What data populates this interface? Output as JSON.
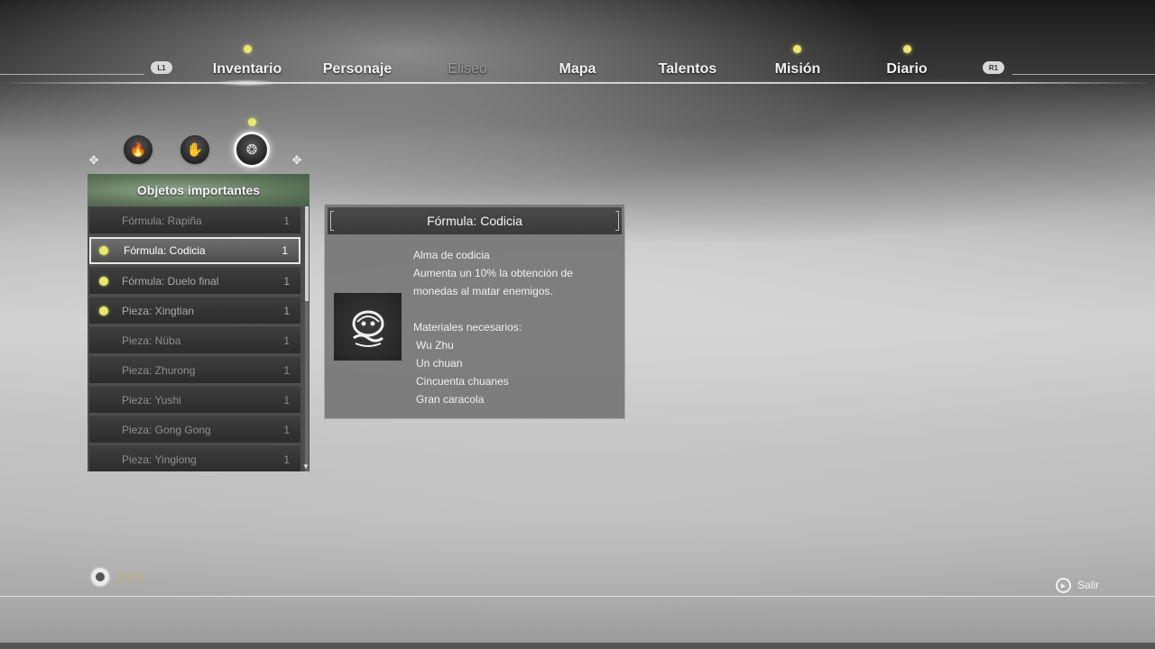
{
  "nav": {
    "left_shoulder": "L1",
    "right_shoulder": "R1",
    "tabs": [
      {
        "label": "Inventario",
        "notification": true,
        "active": true,
        "dim": false
      },
      {
        "label": "Personaje",
        "notification": false,
        "active": false,
        "dim": false
      },
      {
        "label": "Eliseo",
        "notification": false,
        "active": false,
        "dim": true
      },
      {
        "label": "Mapa",
        "notification": false,
        "active": false,
        "dim": false
      },
      {
        "label": "Talentos",
        "notification": false,
        "active": false,
        "dim": false
      },
      {
        "label": "Misión",
        "notification": true,
        "active": false,
        "dim": false
      },
      {
        "label": "Diario",
        "notification": true,
        "active": false,
        "dim": false
      }
    ]
  },
  "categories": [
    {
      "icon": "flame-icon",
      "selected": false,
      "notification": false
    },
    {
      "icon": "hand-icon",
      "selected": false,
      "notification": false
    },
    {
      "icon": "relic-icon",
      "selected": true,
      "notification": true
    }
  ],
  "list": {
    "header": "Objetos importantes",
    "items": [
      {
        "name": "Fórmula: Rapiña",
        "qty": "1",
        "star": false,
        "selected": false
      },
      {
        "name": "Fórmula: Codicia",
        "qty": "1",
        "star": true,
        "selected": true
      },
      {
        "name": "Fórmula: Duelo final",
        "qty": "1",
        "star": true,
        "selected": false
      },
      {
        "name": "Pieza: Xingtian",
        "qty": "1",
        "star": true,
        "selected": false
      },
      {
        "name": "Pieza: Nüba",
        "qty": "1",
        "star": false,
        "selected": false
      },
      {
        "name": "Pieza: Zhurong",
        "qty": "1",
        "star": false,
        "selected": false
      },
      {
        "name": "Pieza: Yushi",
        "qty": "1",
        "star": false,
        "selected": false
      },
      {
        "name": "Pieza: Gong Gong",
        "qty": "1",
        "star": false,
        "selected": false
      },
      {
        "name": "Pieza: Yinglong",
        "qty": "1",
        "star": false,
        "selected": false
      }
    ]
  },
  "detail": {
    "title": "Fórmula: Codicia",
    "subtitle": "Alma de codicia",
    "description_line1": "Aumenta un 10% la obtención de",
    "description_line2": "monedas al matar enemigos.",
    "materials_label": "Materiales necesarios:",
    "materials": [
      "Wu Zhu",
      "Un chuan",
      "Cincuenta chuanes",
      "Gran caracola"
    ]
  },
  "footer": {
    "currency_value": "3203",
    "exit_label": "Salir",
    "exit_button_icon": "circle-button-icon"
  },
  "colors": {
    "notification": "#e8e96a",
    "header_green": "#5d7459"
  }
}
